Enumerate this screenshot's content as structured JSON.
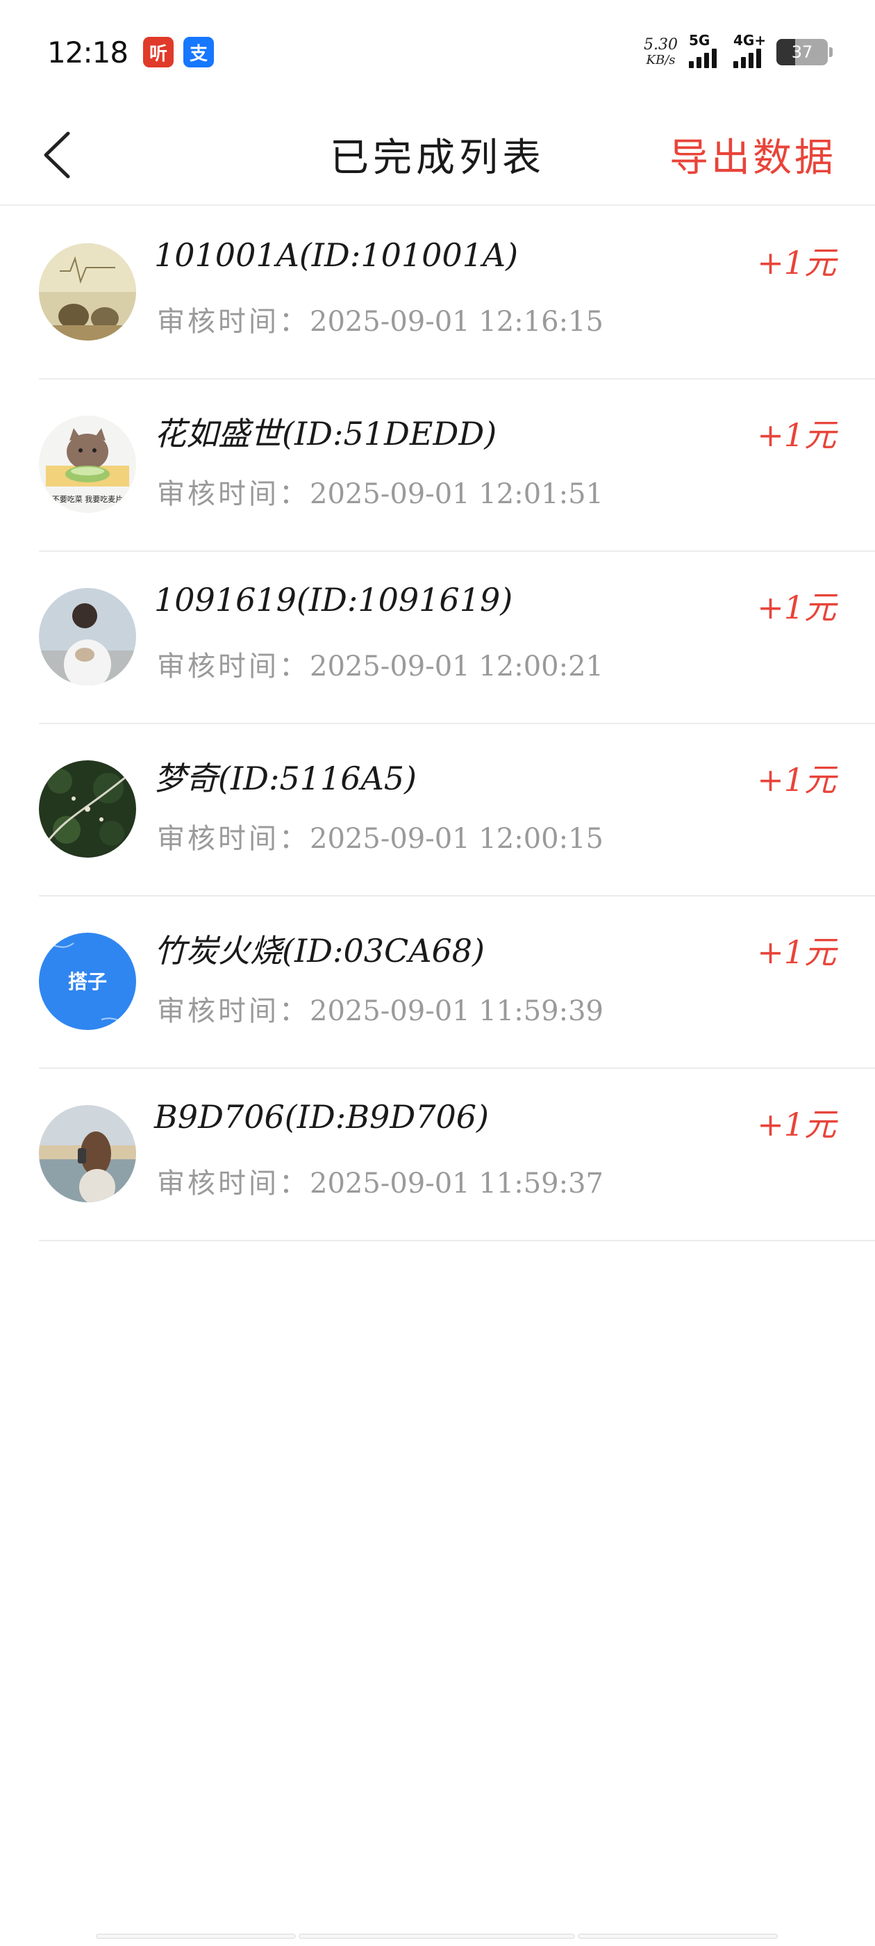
{
  "status_bar": {
    "time": "12:18",
    "app_badges": [
      "听",
      "支"
    ],
    "net_speed": "5.30",
    "net_speed_unit": "KB/s",
    "signal_1_label": "5G",
    "signal_2_label": "4G+",
    "battery_level": "37",
    "battery_fraction": 0.37
  },
  "nav": {
    "back_icon": "chevron-left-icon",
    "title": "已完成列表",
    "export_label": "导出数据"
  },
  "colors": {
    "accent": "#e8443a",
    "secondary_text": "#9a9a9a",
    "divider": "#ececec"
  },
  "records": [
    {
      "name": "101001A(ID:101001A)",
      "time_label": "审核时间：",
      "time": "2025-09-01 12:16:15",
      "reward": "+1元",
      "avatar": "scenery-avatar"
    },
    {
      "name": "花如盛世(ID:51DEDD)",
      "time_label": "审核时间：",
      "time": "2025-09-01 12:01:51",
      "reward": "+1元",
      "avatar": "cat-bowl-avatar",
      "avatar_text": "不要吃菜 我要吃麦片"
    },
    {
      "name": "1091619(ID:1091619)",
      "time_label": "审核时间：",
      "time": "2025-09-01 12:00:21",
      "reward": "+1元",
      "avatar": "person-photo-avatar"
    },
    {
      "name": "梦奇(ID:5116A5)",
      "time_label": "审核时间：",
      "time": "2025-09-01 12:00:15",
      "reward": "+1元",
      "avatar": "forest-avatar"
    },
    {
      "name": "竹炭火烧(ID:03CA68)",
      "time_label": "审核时间：",
      "time": "2025-09-01 11:59:39",
      "reward": "+1元",
      "avatar": "blue-text-avatar",
      "avatar_text": "搭子"
    },
    {
      "name": "B9D706(ID:B9D706)",
      "time_label": "审核时间：",
      "time": "2025-09-01 11:59:37",
      "reward": "+1元",
      "avatar": "beach-girl-avatar"
    }
  ]
}
